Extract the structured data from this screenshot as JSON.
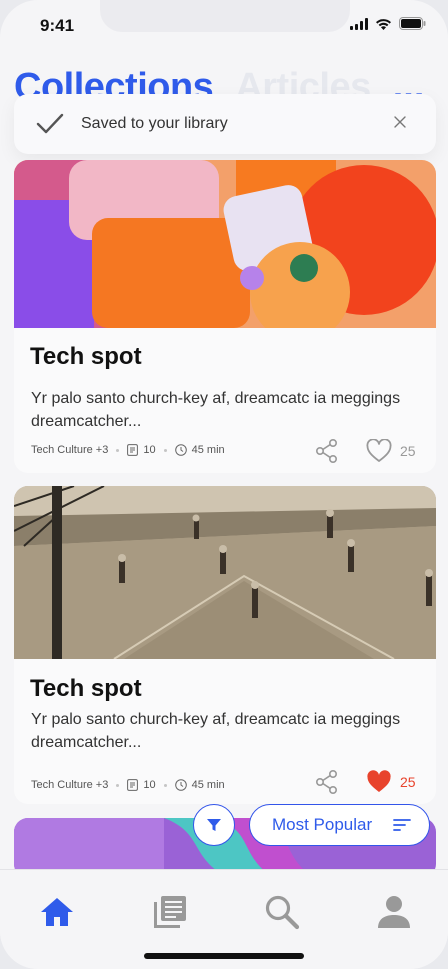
{
  "status_bar": {
    "time": "9:41"
  },
  "header": {
    "tabs": [
      {
        "label": "Collections",
        "active": true
      },
      {
        "label": "Articles",
        "active": false
      }
    ],
    "more_label": "..."
  },
  "toast": {
    "message": "Saved to your library"
  },
  "cards": [
    {
      "title": "Tech spot",
      "description": "Yr palo santo church-key af, dreamcatc ia meggings dreamcatcher...",
      "category": "Tech Culture +3",
      "articles": "10",
      "duration": "45 min",
      "likes": "25",
      "liked": false
    },
    {
      "title": "Tech spot",
      "description": "Yr palo santo church-key af, dreamcatc ia meggings dreamcatcher...",
      "category": "Tech Culture +3",
      "articles": "10",
      "duration": "45 min",
      "likes": "25",
      "liked": true
    }
  ],
  "sort": {
    "label": "Most Popular"
  },
  "colors": {
    "accent": "#2f5bea",
    "liked": "#e8432c",
    "muted": "#999999"
  },
  "nav": [
    "home-icon",
    "library-icon",
    "search-icon",
    "profile-icon"
  ]
}
